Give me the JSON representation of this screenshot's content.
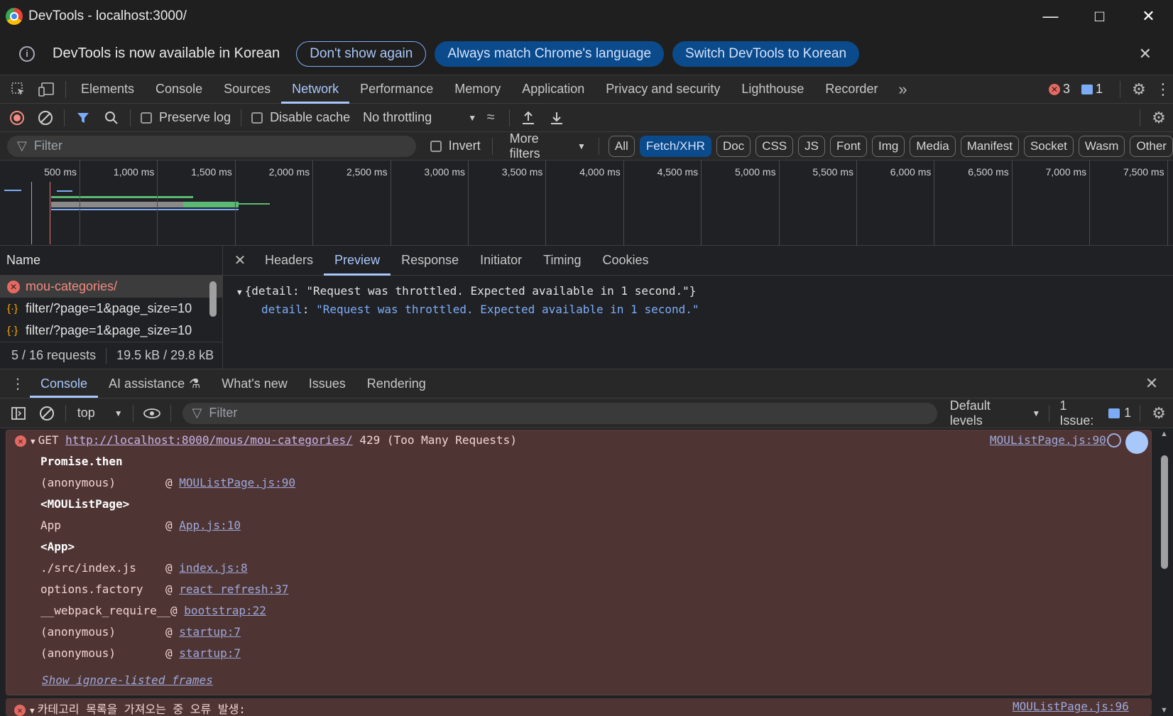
{
  "window": {
    "title": "DevTools - localhost:3000/"
  },
  "infobar": {
    "text": "DevTools is now available in Korean",
    "btn_dont_show": "Don't show again",
    "btn_match": "Always match Chrome's language",
    "btn_switch": "Switch DevTools to Korean"
  },
  "main_tabs": [
    "Elements",
    "Console",
    "Sources",
    "Network",
    "Performance",
    "Memory",
    "Application",
    "Privacy and security",
    "Lighthouse",
    "Recorder"
  ],
  "active_main_tab": "Network",
  "badges": {
    "errors": "3",
    "messages": "1"
  },
  "network_toolbar": {
    "preserve_log": "Preserve log",
    "disable_cache": "Disable cache",
    "throttling": "No throttling"
  },
  "filter_bar": {
    "placeholder": "Filter",
    "invert": "Invert",
    "more_filters": "More filters",
    "types": [
      "All",
      "Fetch/XHR",
      "Doc",
      "CSS",
      "JS",
      "Font",
      "Img",
      "Media",
      "Manifest",
      "Socket",
      "Wasm",
      "Other"
    ],
    "active_type": "Fetch/XHR"
  },
  "overview": {
    "ticks": [
      "500 ms",
      "1,000 ms",
      "1,500 ms",
      "2,000 ms",
      "2,500 ms",
      "3,000 ms",
      "3,500 ms",
      "4,000 ms",
      "4,500 ms",
      "5,000 ms",
      "5,500 ms",
      "6,000 ms",
      "6,500 ms",
      "7,000 ms",
      "7,500 ms"
    ]
  },
  "requests": {
    "header": "Name",
    "rows": [
      {
        "name": "mou-categories/",
        "error": true
      },
      {
        "name": "filter/?page=1&page_size=10",
        "error": false
      },
      {
        "name": "filter/?page=1&page_size=10",
        "error": false
      }
    ],
    "status_count": "5 / 16 requests",
    "status_size": "19.5 kB / 29.8 kB"
  },
  "detail": {
    "tabs": [
      "Headers",
      "Preview",
      "Response",
      "Initiator",
      "Timing",
      "Cookies"
    ],
    "active_tab": "Preview",
    "preview_line1": "{detail: \"Request was throttled. Expected available in 1 second.\"}",
    "preview_key": "detail",
    "preview_value": "\"Request was throttled. Expected available in 1 second.\""
  },
  "drawer": {
    "tabs": [
      "Console",
      "AI assistance",
      "What's new",
      "Issues",
      "Rendering"
    ],
    "active_tab": "Console",
    "context": "top",
    "filter_placeholder": "Filter",
    "levels": "Default levels",
    "issues": "1 Issue:",
    "issues_count": "1"
  },
  "console": {
    "error1": {
      "method": "GET",
      "url": "http://localhost:8000/mous/mou-categories/",
      "status": "429 (Too Many Requests)",
      "source": "MOUListPage.js:90"
    },
    "stack": [
      {
        "fn": "Promise.then",
        "loc": "",
        "heading": true
      },
      {
        "fn": "(anonymous)",
        "loc": "MOUListPage.js:90",
        "heading": false
      },
      {
        "fn": "<MOUListPage>",
        "loc": "",
        "heading": true
      },
      {
        "fn": "App",
        "loc": "App.js:10",
        "heading": false
      },
      {
        "fn": "<App>",
        "loc": "",
        "heading": true
      },
      {
        "fn": "./src/index.js",
        "loc": "index.js:8",
        "heading": false
      },
      {
        "fn": "options.factory",
        "loc": "react refresh:37",
        "heading": false
      },
      {
        "fn": "__webpack_require__",
        "loc": "bootstrap:22",
        "heading": false
      },
      {
        "fn": "(anonymous)",
        "loc": "startup:7",
        "heading": false
      },
      {
        "fn": "(anonymous)",
        "loc": "startup:7",
        "heading": false
      }
    ],
    "show_ignored": "Show ignore-listed frames",
    "error2": {
      "text": "카테고리 목록을 가져오는 중 오류 발생:",
      "source": "MOUListPage.js:96"
    }
  }
}
